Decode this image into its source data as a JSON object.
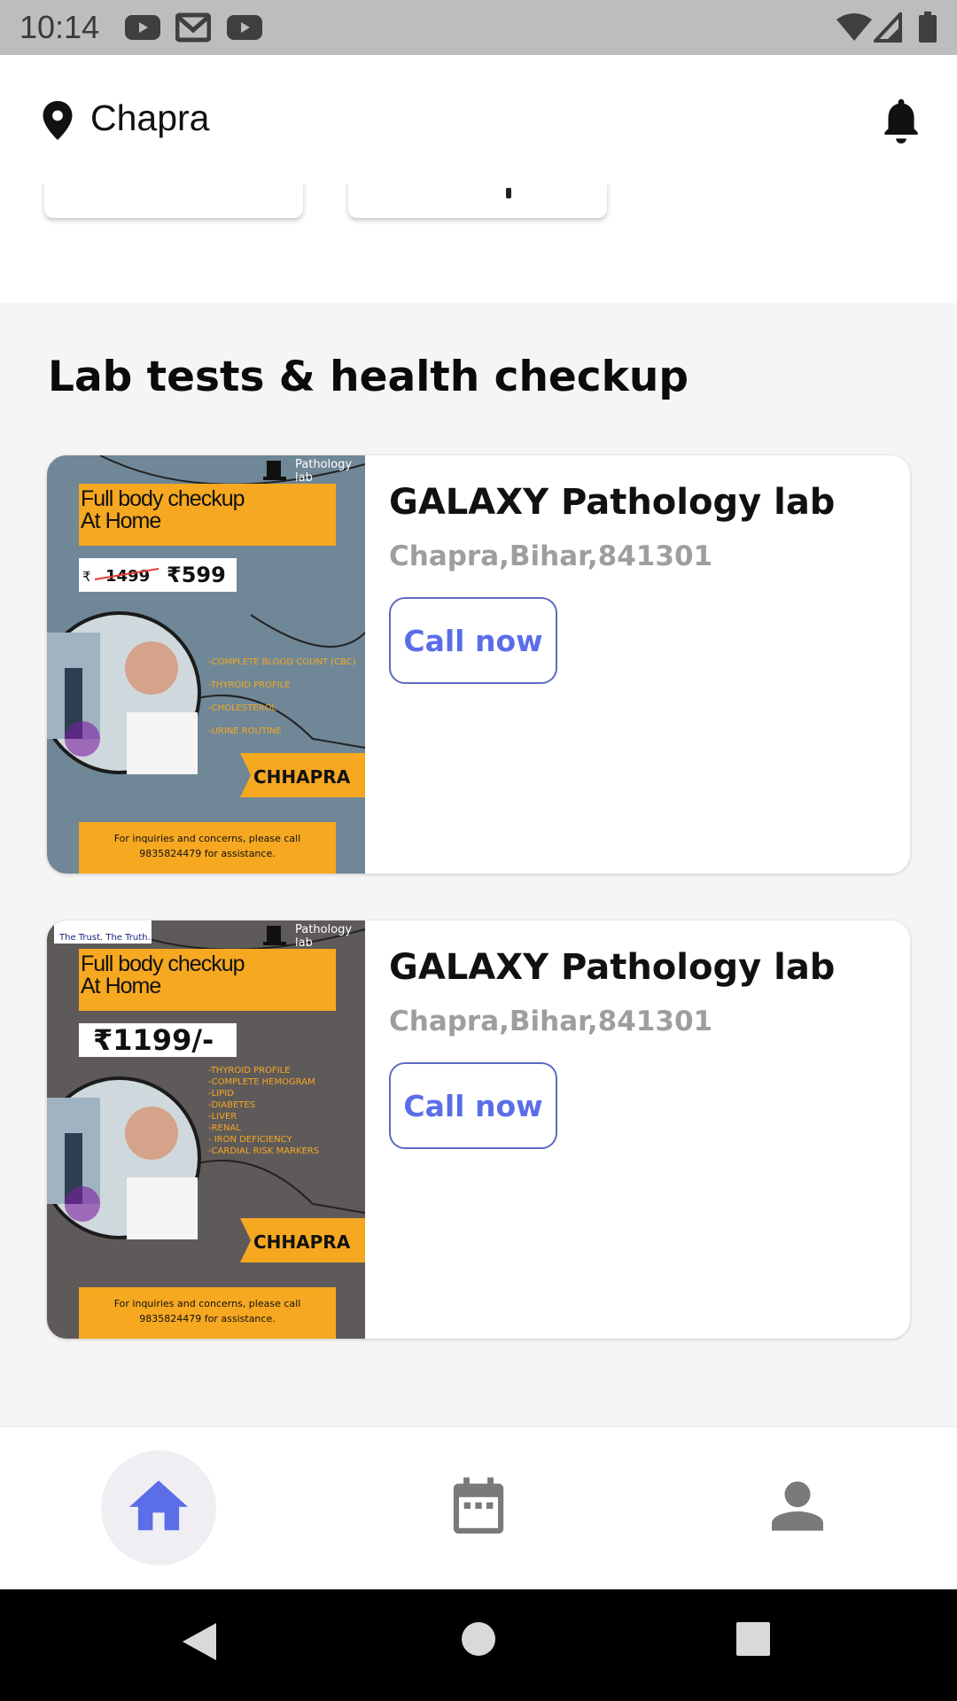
{
  "status_bar": {
    "time": "10:14",
    "notification_icons": [
      "youtube-icon",
      "gmail-icon",
      "youtube-icon"
    ],
    "system_icons": [
      "wifi-icon",
      "signal-icon",
      "battery-icon"
    ]
  },
  "header": {
    "location_icon": "location-pin-icon",
    "location": "Chapra",
    "notification_icon": "bell-icon"
  },
  "section": {
    "title": "Lab tests & health checkup"
  },
  "labs": [
    {
      "name": "GALAXY Pathology lab",
      "address": "Chapra,Bihar,841301",
      "call_label": "Call now",
      "banner": {
        "brand": "Pathology lab",
        "headline_1": "Full body checkup",
        "headline_2": "At Home",
        "old_price": "1499",
        "price": "599",
        "currency": "₹",
        "tests": [
          "-COMPLETE BLOOD COUNT (CBC)",
          "-THYROID PROFILE",
          "-CHOLESTEROL",
          "-URINE ROUTINE"
        ],
        "city": "CHHAPRA",
        "footer_1": "For inquiries and concerns, please call",
        "footer_2": "9835824479 for assistance.",
        "bg": "#6f8797"
      }
    },
    {
      "name": "GALAXY Pathology lab",
      "address": "Chapra,Bihar,841301",
      "call_label": "Call now",
      "banner": {
        "brand": "Pathology lab",
        "partner": "The Trust. The Truth.",
        "headline_1": "Full body checkup",
        "headline_2": "At Home",
        "price": "₹1199/-",
        "tests": [
          "-THYROID PROFILE",
          "-COMPLETE HEMOGRAM",
          "-LIPID",
          "-DIABETES",
          "-LIVER",
          "-RENAL",
          "- IRON DEFICIENCY",
          "-CARDIAL RISK MARKERS"
        ],
        "city": "CHHAPRA",
        "footer_1": "For inquiries and concerns, please call",
        "footer_2": "9835824479 for assistance.",
        "bg": "#5f5a5a"
      }
    }
  ],
  "bottom_nav": {
    "items": [
      {
        "icon": "home-icon",
        "active": true
      },
      {
        "icon": "calendar-icon",
        "active": false
      },
      {
        "icon": "person-icon",
        "active": false
      }
    ],
    "accent": "#5b6ee8",
    "inactive": "#7a7a7a"
  },
  "system_nav": [
    "back-icon",
    "home-circle-icon",
    "recents-icon"
  ]
}
